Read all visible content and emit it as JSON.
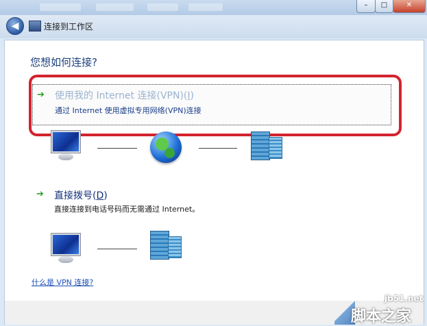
{
  "window": {
    "close_glyph": "✕",
    "minimize_glyph": "–",
    "maximize_glyph": "□"
  },
  "nav": {
    "back_glyph": "◀",
    "title": "连接到工作区"
  },
  "heading": "您想如何连接?",
  "options": [
    {
      "title_prefix": "使用我的 Internet 连接(VPN)(",
      "accesskey": "I",
      "title_suffix": ")",
      "description": "通过 Internet 使用虚拟专用网络(VPN)连接",
      "icon": "green-arrow-icon",
      "highlighted": true
    },
    {
      "title_prefix": "直接拨号(",
      "accesskey": "D",
      "title_suffix": ")",
      "description": "直接连接到电话号码而无需通过 Internet。",
      "icon": "green-arrow-icon",
      "highlighted": false
    }
  ],
  "links": {
    "what_is_vpn": "什么是 VPN 连接?"
  },
  "watermark": {
    "url": "jb51.net",
    "brand": "脚本之家"
  },
  "colors": {
    "highlight_border": "#d3232d",
    "heading": "#1c3f7c",
    "link": "#1a4fb8"
  }
}
